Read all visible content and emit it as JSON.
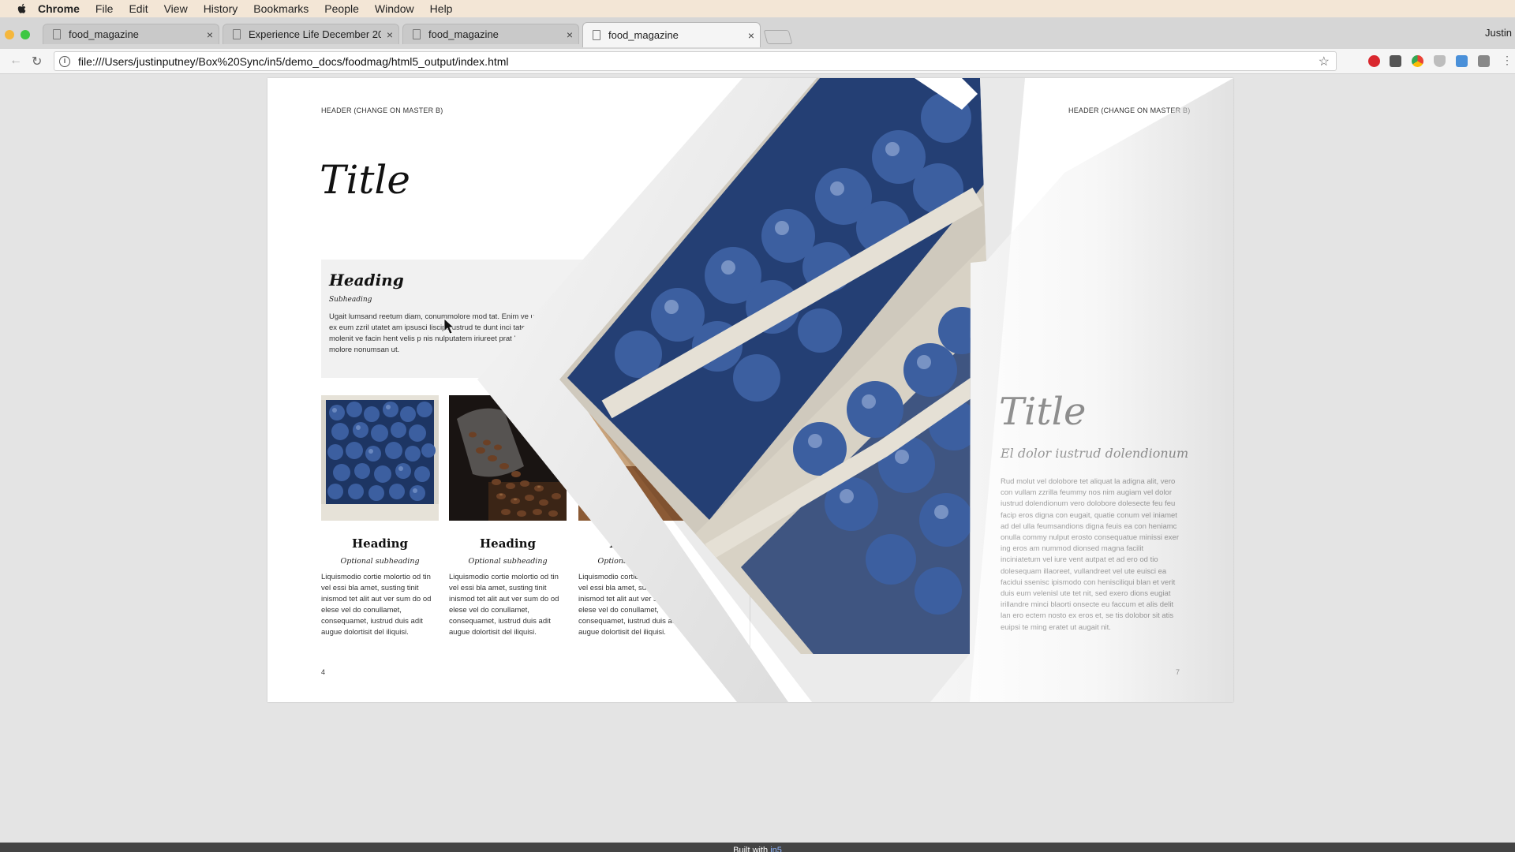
{
  "menubar": {
    "items": [
      "Chrome",
      "File",
      "Edit",
      "View",
      "History",
      "Bookmarks",
      "People",
      "Window",
      "Help"
    ]
  },
  "tabs": [
    {
      "title": "food_magazine",
      "close": "×"
    },
    {
      "title": "Experience Life December 20",
      "close": "×"
    },
    {
      "title": "food_magazine",
      "close": "×"
    },
    {
      "title": "food_magazine",
      "close": "×"
    }
  ],
  "profile": {
    "name": "Justin"
  },
  "toolbar": {
    "back_glyph": "←",
    "reload_glyph": "↻",
    "url": "file:///Users/justinputney/Box%20Sync/in5/demo_docs/foodmag/html5_output/index.html",
    "info_glyph": "i",
    "star_glyph": "☆"
  },
  "left_page": {
    "header": "HEADER (CHANGE ON MASTER B)",
    "title": "Title",
    "box": {
      "heading": "Heading",
      "subheading": "Subheading",
      "body": "Ugait lumsand reetum diam, conummolore mod tat. Enim ve ullamcons ex eum zzril utatet am ipsusci liscips ustrud te dunt inci tatem diamcom molenit ve facin hent velis p nis nulputatem iriureet prat luptate vullute molore nonumsan ut."
    },
    "cards": [
      {
        "heading": "Heading",
        "subheading": "Optional subheading",
        "body": "Liquismodio cortie molortio od tin vel essi bla amet, susting tinit inismod tet alit aut ver sum do od elese vel do conullamet, consequamet, iustrud duis adit augue dolortisit del iliquisi."
      },
      {
        "heading": "Heading",
        "subheading": "Optional subheading",
        "body": "Liquismodio cortie molortio od tin vel essi bla amet, susting tinit inismod tet alit aut ver sum do od elese vel do conullamet, consequamet, iustrud duis adit augue dolortisit del iliquisi."
      },
      {
        "heading": "Heading",
        "subheading": "Optional subheading",
        "body": "Liquismodio cortie molortio od tin vel essi bla amet, susting tinit inismod tet alit aut ver sum do od elese vel do conullamet, consequamet, iustrud duis adit augue dolortisit del iliquisi."
      }
    ],
    "page_number": "4"
  },
  "right_page": {
    "header": "HEADER (CHANGE ON MASTER B)",
    "title": "Title",
    "subtitle": "El dolor iustrud dolendionum",
    "body": "Rud molut vel dolobore tet aliquat la adigna alit, vero con vullam zzrilla feummy nos nim augiam vel dolor iustrud dolendionum vero dolobore dolesecte feu feu facip eros digna con eugait, quatie conum vel iniamet ad del ulla feumsandions digna feuis ea con heniamc onulla commy nulput erosto consequatue minissi exer ing eros am nummod dionsed magna facilit inciniatetum vel iure vent autpat et ad ero od tio dolesequam illaoreet, vullandreet vel ute euisci ea facidui ssenisc ipismodo con henisciliqui blan et verit duis eum velenisl ute tet nit, sed exero dions eugiat irillandre minci blaorti onsecte eu faccum et alis delit lan ero ectem nosto ex eros et, se tis dolobor sit atis euipsi te ming eratet ut augait nit.",
    "page_number": "7"
  },
  "footer": {
    "prefix": "Built with",
    "link": "in5"
  },
  "colors": {
    "accent_link": "#8fb6ff",
    "blueberry": "#2f4e8c",
    "page_bg": "#e4e4e4"
  }
}
